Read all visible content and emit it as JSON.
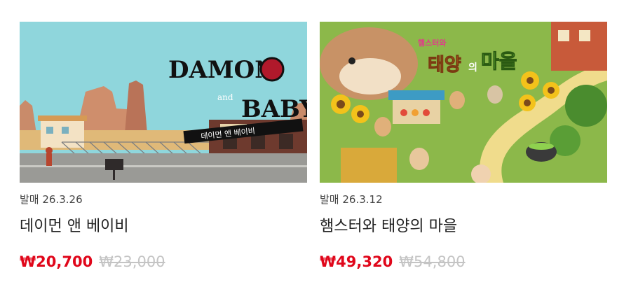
{
  "products": [
    {
      "title": "데이먼 앤 베이비",
      "release": "발매 26.3.26",
      "sale_price": "₩20,700",
      "original_price": "₩23,000",
      "thumb_logo": {
        "line1": "DAMON",
        "amp": "and",
        "line2": "BABY",
        "banner": "데이먼 앤 베이비"
      },
      "colors": {
        "sky": "#8fd6dc",
        "road": "#9a9a96"
      }
    },
    {
      "title": "햄스터와 태양의 마을",
      "release": "발매 26.3.12",
      "sale_price": "₩49,320",
      "original_price": "₩54,800",
      "thumb_logo": {
        "small": "햄스터와",
        "big1": "태양",
        "mid": "의",
        "big2": "마을"
      },
      "colors": {
        "grass": "#8cb84a",
        "path": "#f0dc8c"
      }
    }
  ],
  "colors": {
    "sale": "#e0061a",
    "original": "#c4c4c4"
  }
}
